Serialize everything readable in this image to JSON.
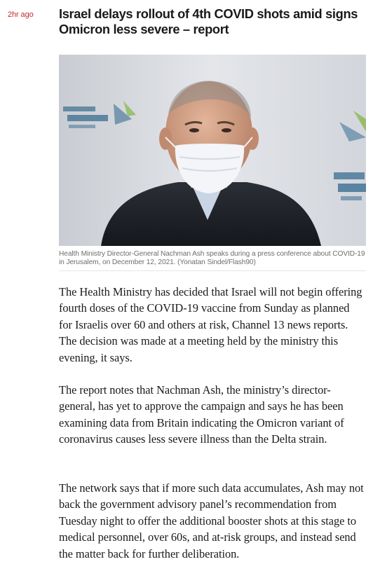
{
  "post": {
    "timestamp": "2hr ago",
    "headline": "Israel delays rollout of 4th COVID shots amid signs Omicron less severe – report",
    "image": {
      "alt": "Health Ministry Director-General Nachman Ash wearing a face mask at a press conference",
      "caption": "Health Ministry Director-General Nachman Ash speaks during a press conference about COVID-19 in Jerusalem, on December 12, 2021. (Yonatan Sindel/Flash90)",
      "background_colors": {
        "backdrop": "#d7dbe0",
        "logo_blue": "#1f5c86",
        "accent_green": "#78b02b"
      }
    },
    "paragraphs": [
      "The Health Ministry has decided that Israel will not begin offering fourth doses of the COVID-19 vaccine from Sunday as planned for Israelis over 60 and others at risk, Channel 13 news reports. The decision was made at a meeting held by the ministry this evening, it says.",
      "The report notes that Nachman Ash, the ministry’s director-general, has yet to approve the campaign and says he has been examining data from Britain indicating the Omicron variant of coronavirus causes less severe illness than the Delta strain.",
      "The network says that if more such data accumulates, Ash may not back the government advisory panel’s recommendation from Tuesday night to offer the additional booster shots at this stage to medical personnel, over 60s, and at-risk groups, and instead send the matter back for further deliberation."
    ]
  },
  "colors": {
    "timestamp": "#c22a2a",
    "headline": "#1a1a1a",
    "caption": "#6e6e6e",
    "body": "#1a1a1a"
  }
}
